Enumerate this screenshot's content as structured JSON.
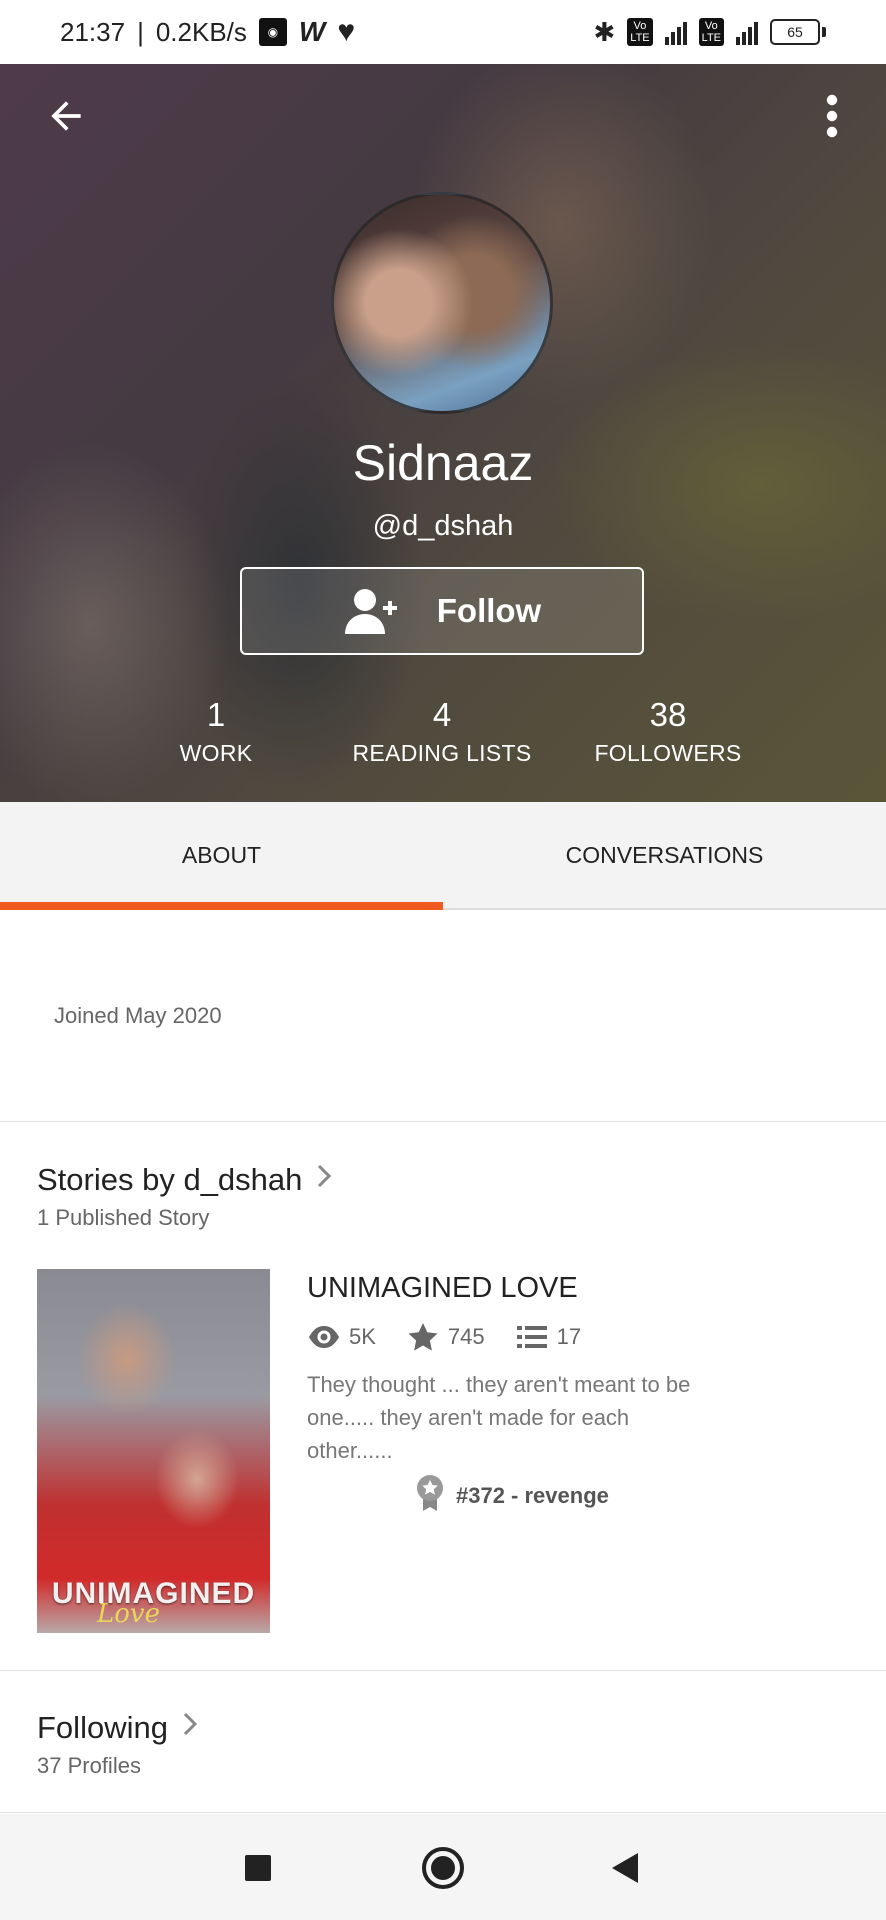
{
  "status_bar": {
    "time": "21:37",
    "speed": "0.2KB/s",
    "battery": "65"
  },
  "profile": {
    "display_name": "Sidnaaz",
    "username": "@d_dshah",
    "follow_label": "Follow",
    "stats": [
      {
        "value": "1",
        "label": "WORK"
      },
      {
        "value": "4",
        "label": "READING LISTS"
      },
      {
        "value": "38",
        "label": "FOLLOWERS"
      }
    ]
  },
  "tabs": [
    {
      "label": "ABOUT",
      "active": true
    },
    {
      "label": "CONVERSATIONS",
      "active": false
    }
  ],
  "about": {
    "joined": "Joined May 2020"
  },
  "stories": {
    "title": "Stories by d_dshah",
    "subtitle": "1 Published Story",
    "items": [
      {
        "title": "UNIMAGINED LOVE",
        "reads": "5K",
        "votes": "745",
        "parts": "17",
        "description": "They thought ... they aren't meant to be one..... they aren't made for each other......",
        "tag": "#372 - revenge",
        "cover_text": "UNIMAGINED",
        "cover_script": "Love"
      }
    ]
  },
  "following": {
    "title": "Following",
    "subtitle": "37 Profiles"
  },
  "colors": {
    "accent": "#f05a1e"
  }
}
